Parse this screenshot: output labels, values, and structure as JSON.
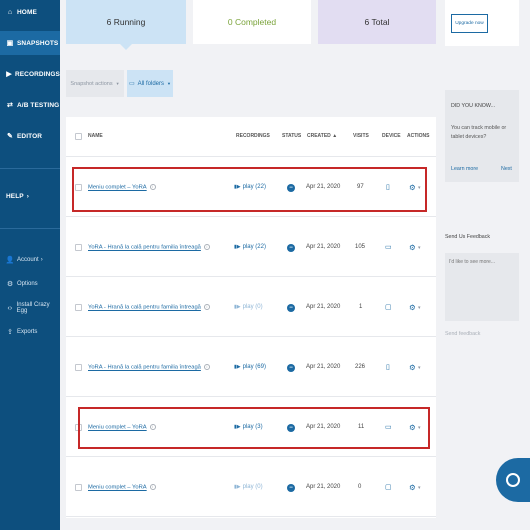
{
  "sidebar": {
    "main": [
      {
        "label": "HOME",
        "icon": "home-icon"
      },
      {
        "label": "SNAPSHOTS",
        "icon": "snapshot-icon"
      },
      {
        "label": "RECORDINGS",
        "icon": "recordings-icon"
      },
      {
        "label": "A/B TESTING",
        "icon": "ab-testing-icon"
      },
      {
        "label": "EDITOR",
        "icon": "pencil-icon"
      }
    ],
    "help": "HELP",
    "sub": [
      {
        "label": "Account",
        "icon": "account-icon"
      },
      {
        "label": "Options",
        "icon": "gear-icon"
      },
      {
        "label": "Install Crazy Egg",
        "icon": "code-icon"
      },
      {
        "label": "Exports",
        "icon": "export-icon"
      }
    ]
  },
  "summary": {
    "running": "6 Running",
    "completed": "0 Completed",
    "total": "6 Total"
  },
  "filters": {
    "actions_label": "Snapshot actions",
    "folders_label": "All folders"
  },
  "table": {
    "headers": {
      "name": "NAME",
      "recordings": "RECORDINGS",
      "status": "STATUS",
      "created": "CREATED",
      "visits": "VISITS",
      "device": "DEVICE",
      "actions": "ACTIONS"
    },
    "rows": [
      {
        "name": "Meniu complet – YoRA",
        "recordings": "play (22)",
        "created": "Apr 21, 2020",
        "visits": "97",
        "device": "mobile"
      },
      {
        "name": "YoRA - Hrană la cală pentru familia întreagă",
        "recordings": "play (22)",
        "created": "Apr 21, 2020",
        "visits": "105",
        "device": "desktop"
      },
      {
        "name": "YoRA - Hrană la cală pentru familia întreagă",
        "recordings": "play (0)",
        "created": "Apr 21, 2020",
        "visits": "1",
        "device": "tablet"
      },
      {
        "name": "YoRA - Hrană la cală pentru familia întreagă",
        "recordings": "play (69)",
        "created": "Apr 21, 2020",
        "visits": "226",
        "device": "mobile"
      },
      {
        "name": "Meniu complet – YoRA",
        "recordings": "play (3)",
        "created": "Apr 21, 2020",
        "visits": "11",
        "device": "desktop"
      },
      {
        "name": "Meniu complet – YoRA",
        "recordings": "play (0)",
        "created": "Apr 21, 2020",
        "visits": "0",
        "device": "tablet"
      }
    ]
  },
  "right": {
    "upgrade": "Upgrade now",
    "dyk_title": "DID YOU KNOW...",
    "dyk_text": "You can track mobile or tablet devices?",
    "learn_more": "Learn more",
    "next": "Next",
    "feedback_title": "Send Us Feedback",
    "feedback_placeholder": "I'd like to see more...",
    "send_feedback": "Send feedback"
  },
  "colors": {
    "sidebar": "#0d4f7e",
    "accent": "#1c6aa3",
    "highlight": "#c62828",
    "completed": "#7aa33a"
  }
}
